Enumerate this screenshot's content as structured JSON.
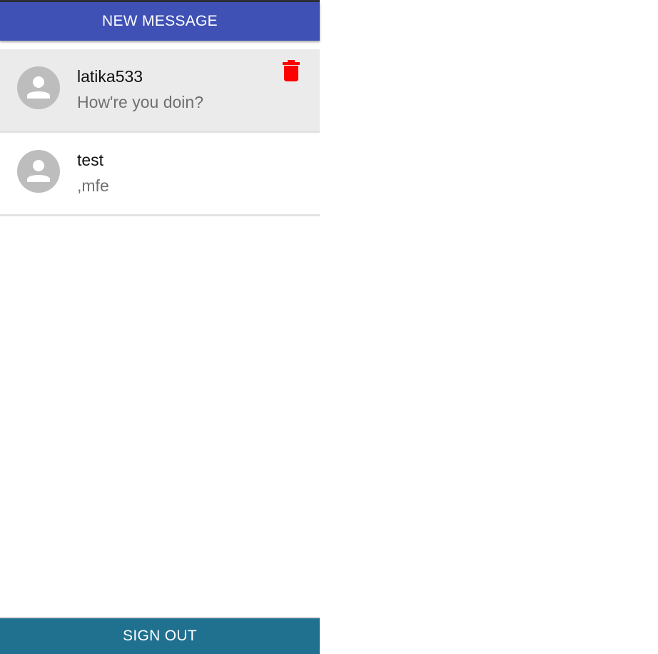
{
  "header": {
    "new_message_label": "NEW MESSAGE",
    "accent_color": "#3f51b5"
  },
  "conversations": [
    {
      "name": "latika533",
      "preview": "How're you doin?",
      "selected": true,
      "avatar_icon": "person-icon",
      "action_icon": "trash-icon",
      "action_color": "#ff0000"
    },
    {
      "name": "test",
      "preview": ",mfe",
      "selected": false,
      "avatar_icon": "person-icon"
    }
  ],
  "footer": {
    "sign_out_label": "SIGN OUT",
    "color": "#207090"
  }
}
